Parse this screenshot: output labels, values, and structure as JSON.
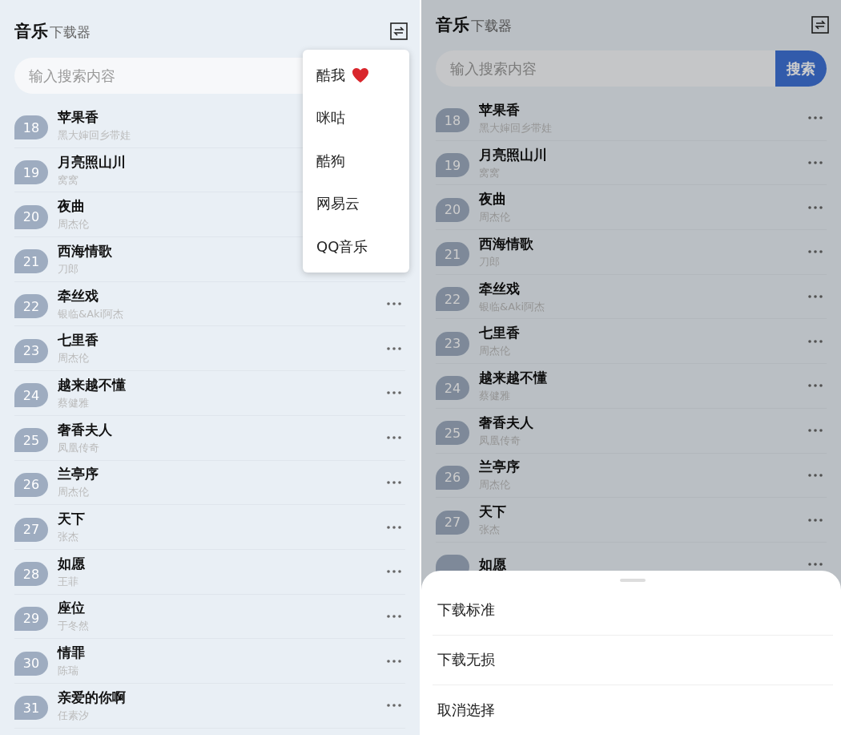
{
  "screens": [
    {
      "dimmed": false,
      "header": {
        "title": "音乐",
        "subtitle": "下载器"
      },
      "search": {
        "placeholder": "输入搜索内容"
      },
      "songs": [
        {
          "number": "18",
          "title": "苹果香",
          "artist": "黑大婶回乡带娃",
          "more_button": false
        },
        {
          "number": "19",
          "title": "月亮照山川",
          "artist": "窝窝",
          "more_button": false
        },
        {
          "number": "20",
          "title": "夜曲",
          "artist": "周杰伦",
          "more_button": false
        },
        {
          "number": "21",
          "title": "西海情歌",
          "artist": "刀郎",
          "more_button": false
        },
        {
          "number": "22",
          "title": "牵丝戏",
          "artist": "银临&Aki阿杰",
          "more_button": true
        },
        {
          "number": "23",
          "title": "七里香",
          "artist": "周杰伦",
          "more_button": true
        },
        {
          "number": "24",
          "title": "越来越不懂",
          "artist": "蔡健雅",
          "more_button": true
        },
        {
          "number": "25",
          "title": "奢香夫人",
          "artist": "凤凰传奇",
          "more_button": true
        },
        {
          "number": "26",
          "title": "兰亭序",
          "artist": "周杰伦",
          "more_button": true
        },
        {
          "number": "27",
          "title": "天下",
          "artist": "张杰",
          "more_button": true
        },
        {
          "number": "28",
          "title": "如愿",
          "artist": "王菲",
          "more_button": true
        },
        {
          "number": "29",
          "title": "座位",
          "artist": "于冬然",
          "more_button": true
        },
        {
          "number": "30",
          "title": "情罪",
          "artist": "陈瑞",
          "more_button": true
        },
        {
          "number": "31",
          "title": "亲爱的你啊",
          "artist": "任素汐",
          "more_button": true
        }
      ],
      "menu": {
        "items": [
          {
            "label": "酷我",
            "heart": true
          },
          {
            "label": "咪咕",
            "heart": false
          },
          {
            "label": "酷狗",
            "heart": false
          },
          {
            "label": "网易云",
            "heart": false
          },
          {
            "label": "QQ音乐",
            "heart": false
          }
        ]
      }
    },
    {
      "dimmed": true,
      "header": {
        "title": "音乐",
        "subtitle": "下载器"
      },
      "search": {
        "placeholder": "输入搜索内容",
        "button": "搜索"
      },
      "songs": [
        {
          "number": "18",
          "title": "苹果香",
          "artist": "黑大婶回乡带娃",
          "more_button": true
        },
        {
          "number": "19",
          "title": "月亮照山川",
          "artist": "窝窝",
          "more_button": true
        },
        {
          "number": "20",
          "title": "夜曲",
          "artist": "周杰伦",
          "more_button": true
        },
        {
          "number": "21",
          "title": "西海情歌",
          "artist": "刀郎",
          "more_button": true
        },
        {
          "number": "22",
          "title": "牵丝戏",
          "artist": "银临&Aki阿杰",
          "more_button": true
        },
        {
          "number": "23",
          "title": "七里香",
          "artist": "周杰伦",
          "more_button": true
        },
        {
          "number": "24",
          "title": "越来越不懂",
          "artist": "蔡健雅",
          "more_button": true
        },
        {
          "number": "25",
          "title": "奢香夫人",
          "artist": "凤凰传奇",
          "more_button": true
        },
        {
          "number": "26",
          "title": "兰亭序",
          "artist": "周杰伦",
          "more_button": true
        },
        {
          "number": "27",
          "title": "天下",
          "artist": "张杰",
          "more_button": true
        },
        {
          "title": "如愿",
          "more_button": true
        }
      ],
      "sheet": {
        "options": [
          "下载标准",
          "下载无损",
          "取消选择"
        ]
      }
    }
  ]
}
